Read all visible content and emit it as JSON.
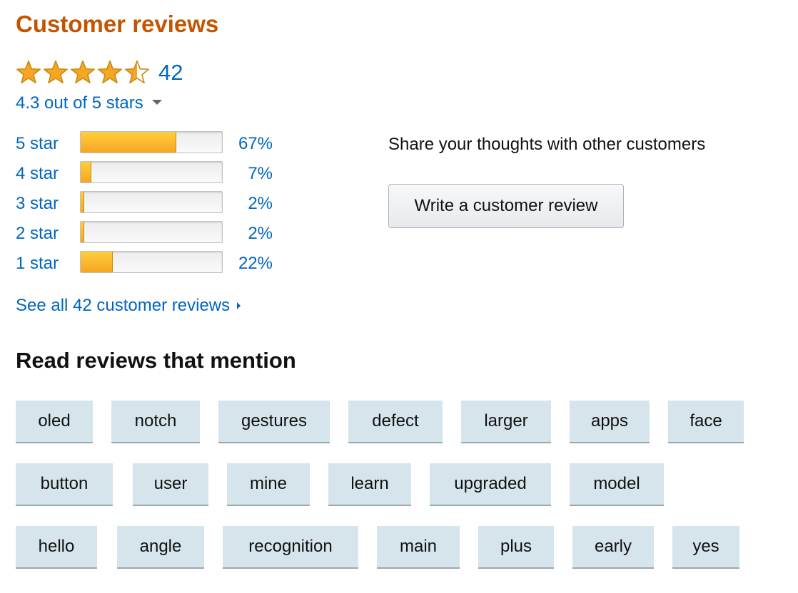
{
  "header": {
    "title": "Customer reviews"
  },
  "rating": {
    "stars_value": 4.5,
    "review_count": "42",
    "summary_text": "4.3 out of 5 stars",
    "star_color": "#f5a623"
  },
  "histogram": [
    {
      "label": "5 star",
      "percent_text": "67%",
      "percent": 67
    },
    {
      "label": "4 star",
      "percent_text": "7%",
      "percent": 7
    },
    {
      "label": "3 star",
      "percent_text": "2%",
      "percent": 2
    },
    {
      "label": "2 star",
      "percent_text": "2%",
      "percent": 2
    },
    {
      "label": "1 star",
      "percent_text": "22%",
      "percent": 22
    }
  ],
  "see_all_link": "See all 42 customer reviews",
  "share": {
    "prompt": "Share your thoughts with other customers",
    "button_label": "Write a customer review"
  },
  "mentions": {
    "title": "Read reviews that mention",
    "chips": [
      "oled",
      "notch",
      "gestures",
      "defect",
      "larger",
      "apps",
      "face",
      "button",
      "user",
      "mine",
      "learn",
      "upgraded",
      "model",
      "hello",
      "angle",
      "recognition",
      "main",
      "plus",
      "early",
      "yes"
    ]
  },
  "colors": {
    "title": "#c45500",
    "link": "#0066c0",
    "chip_bg": "#d5e5eb",
    "bar_fill": "#f5a623"
  }
}
